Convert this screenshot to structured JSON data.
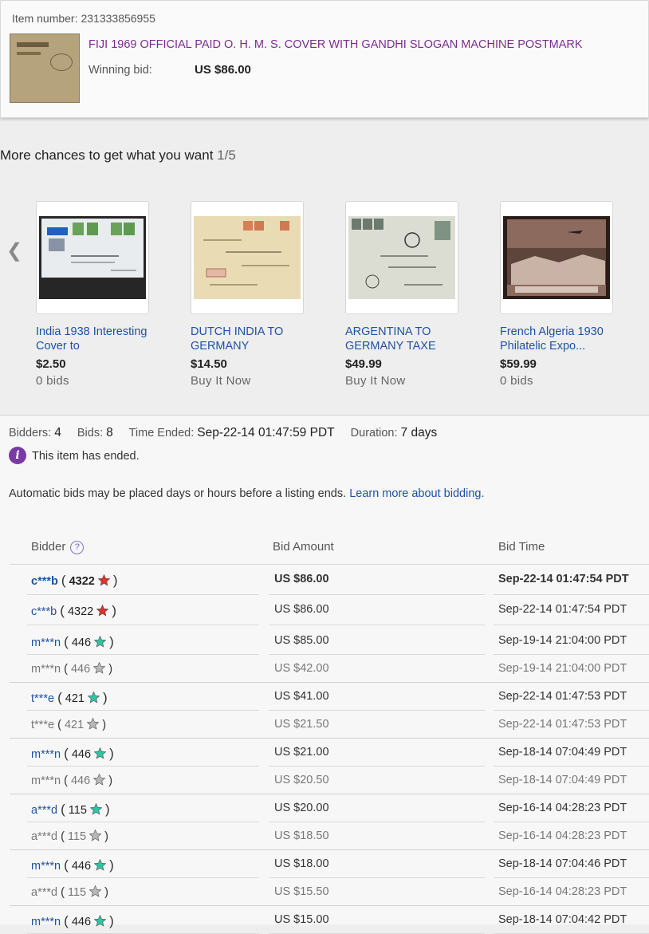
{
  "item": {
    "number_label": "Item number:",
    "number": "231333856955",
    "title": "FIJI 1969 OFFICIAL PAID O. H. M. S. COVER WITH GANDHI SLOGAN MACHINE POSTMARK",
    "winning_bid_label": "Winning bid:",
    "winning_bid": "US $86.00"
  },
  "chances": {
    "title": "More chances to get what you want",
    "count": "1/5",
    "prev_icon": "chevron-left-icon",
    "cards": [
      {
        "title": "India 1938 Interesting Cover to",
        "price": "$2.50",
        "sub": "0 bids"
      },
      {
        "title": "DUTCH INDIA TO GERMANY",
        "price": "$14.50",
        "sub": "Buy It Now"
      },
      {
        "title": "ARGENTINA TO GERMANY TAXE",
        "price": "$49.99",
        "sub": "Buy It Now"
      },
      {
        "title": "French Algeria 1930 Philatelic Expo...",
        "price": "$59.99",
        "sub": "0 bids"
      }
    ]
  },
  "summary": {
    "bidders_label": "Bidders:",
    "bidders": "4",
    "bids_label": "Bids:",
    "bids": "8",
    "time_ended_label": "Time Ended:",
    "time_ended": "Sep-22-14 01:47:59 PDT",
    "duration_label": "Duration:",
    "duration": "7 days",
    "ended_text": "This item has ended.",
    "auto_text": "Automatic bids may be placed days or hours before a listing ends.",
    "learn_more": "Learn more about bidding."
  },
  "table": {
    "headers": {
      "bidder": "Bidder",
      "amount": "Bid Amount",
      "time": "Bid Time"
    },
    "rows": [
      {
        "bidder": "c***b",
        "feedback": "4322",
        "amount": "US $86.00",
        "time": "Sep-22-14 01:47:54 PDT"
      },
      {
        "bidder": "c***b",
        "feedback": "4322",
        "amount": "US $86.00",
        "time": "Sep-22-14 01:47:54 PDT"
      },
      {
        "bidder": "m***n",
        "feedback": "446",
        "amount": "US $85.00",
        "time": "Sep-19-14 21:04:00 PDT"
      },
      {
        "bidder": "m***n",
        "feedback": "446",
        "amount": "US $42.00",
        "time": "Sep-19-14 21:04:00 PDT"
      },
      {
        "bidder": "t***e",
        "feedback": "421",
        "amount": "US $41.00",
        "time": "Sep-22-14 01:47:53 PDT"
      },
      {
        "bidder": "t***e",
        "feedback": "421",
        "amount": "US $21.50",
        "time": "Sep-22-14 01:47:53 PDT"
      },
      {
        "bidder": "m***n",
        "feedback": "446",
        "amount": "US $21.00",
        "time": "Sep-18-14 07:04:49 PDT"
      },
      {
        "bidder": "m***n",
        "feedback": "446",
        "amount": "US $20.50",
        "time": "Sep-18-14 07:04:49 PDT"
      },
      {
        "bidder": "a***d",
        "feedback": "115",
        "amount": "US $20.00",
        "time": "Sep-16-14 04:28:23 PDT"
      },
      {
        "bidder": "a***d",
        "feedback": "115",
        "amount": "US $18.50",
        "time": "Sep-16-14 04:28:23 PDT"
      },
      {
        "bidder": "m***n",
        "feedback": "446",
        "amount": "US $18.00",
        "time": "Sep-18-14 07:04:46 PDT"
      },
      {
        "bidder": "a***d",
        "feedback": "115",
        "amount": "US $15.50",
        "time": "Sep-16-14 04:28:23 PDT"
      },
      {
        "bidder": "m***n",
        "feedback": "446",
        "amount": "US $15.00",
        "time": "Sep-18-14 07:04:42 PDT"
      }
    ]
  },
  "colors": {
    "link": "#1f51a3",
    "title_purple": "#7b2d8f",
    "star_red": "#e0312a",
    "star_teal": "#2fc4a3",
    "star_grey": "#b9b9b9"
  }
}
